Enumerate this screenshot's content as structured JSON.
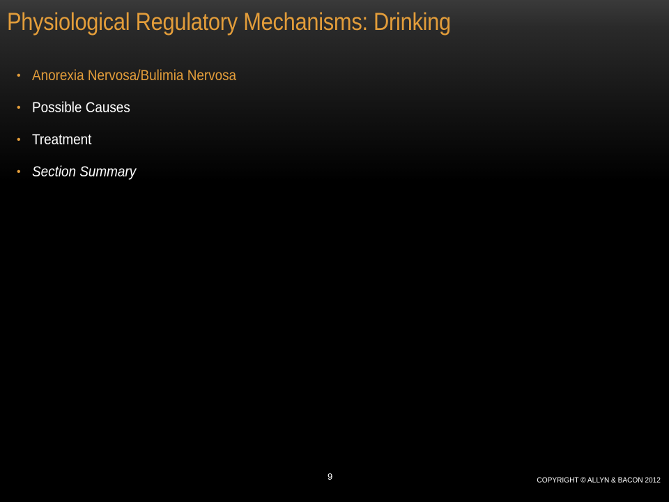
{
  "slide": {
    "title": "Physiological Regulatory Mechanisms: Drinking",
    "bullets": [
      {
        "text": "Anorexia Nervosa/Bulimia Nervosa",
        "style": "accent"
      },
      {
        "text": "Possible Causes",
        "style": "normal"
      },
      {
        "text": "Treatment",
        "style": "normal"
      },
      {
        "text": "Section Summary",
        "style": "italic"
      }
    ],
    "page_number": "9",
    "copyright": "COPYRIGHT © ALLYN & BACON 2012"
  },
  "colors": {
    "accent": "#e39d3a",
    "text": "#ffffff",
    "background": "#000000"
  }
}
